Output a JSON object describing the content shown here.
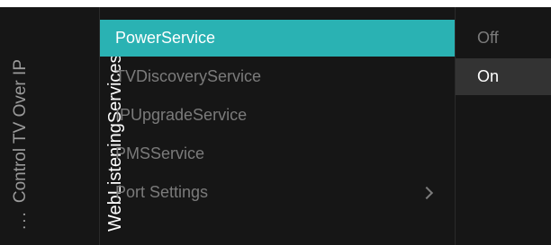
{
  "breadcrumb": {
    "ellipsis": "...",
    "parent": "Control TV Over IP",
    "current": "WebListeningServices"
  },
  "menu": {
    "items": [
      {
        "label": "PowerService",
        "selected": true,
        "has_submenu": false
      },
      {
        "label": "TVDiscoveryService",
        "selected": false,
        "has_submenu": false
      },
      {
        "label": "IPUpgradeService",
        "selected": false,
        "has_submenu": false
      },
      {
        "label": "PMSService",
        "selected": false,
        "has_submenu": false
      },
      {
        "label": "Port Settings",
        "selected": false,
        "has_submenu": true
      }
    ]
  },
  "options": {
    "items": [
      {
        "label": "Off",
        "active": false
      },
      {
        "label": "On",
        "active": true
      }
    ]
  },
  "colors": {
    "background": "#161616",
    "highlight": "#2ab2b3",
    "option_active_bg": "#333333",
    "text_dim": "#7b7b7b",
    "text_bright": "#ffffff"
  }
}
